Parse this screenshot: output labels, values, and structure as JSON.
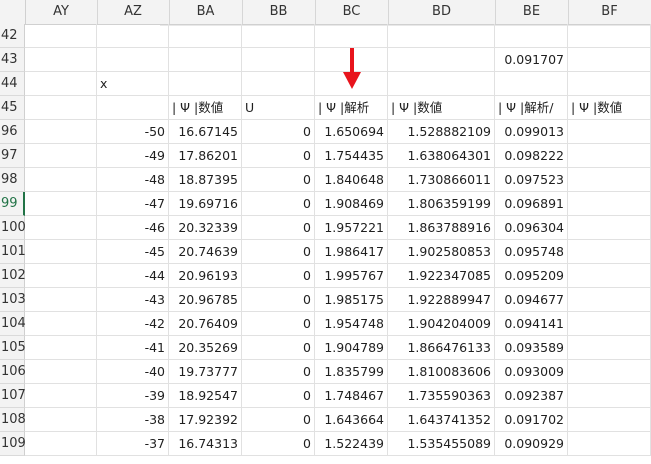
{
  "columns": [
    "AY",
    "AZ",
    "BA",
    "BB",
    "BC",
    "BD",
    "BE",
    "BF"
  ],
  "rows": [
    {
      "num": "42",
      "cells": [
        "",
        "",
        "",
        "",
        "",
        "",
        "",
        ""
      ]
    },
    {
      "num": "43",
      "cells": [
        "",
        "",
        "",
        "",
        "",
        "",
        "0.091707",
        ""
      ]
    },
    {
      "num": "44",
      "cells": [
        "",
        "x",
        "",
        "",
        "",
        "",
        "",
        ""
      ]
    },
    {
      "num": "45",
      "cells": [
        "",
        "",
        "| Ψ |数値",
        "U",
        "| Ψ |解析",
        "| Ψ |数値",
        "| Ψ |解析/",
        "| Ψ |数値"
      ]
    },
    {
      "num": "96",
      "cells": [
        "",
        "-50",
        "16.67145",
        "0",
        "1.650694",
        "1.528882109",
        "0.099013",
        ""
      ]
    },
    {
      "num": "97",
      "cells": [
        "",
        "-49",
        "17.86201",
        "0",
        "1.754435",
        "1.638064301",
        "0.098222",
        ""
      ]
    },
    {
      "num": "98",
      "cells": [
        "",
        "-48",
        "18.87395",
        "0",
        "1.840648",
        "1.730866011",
        "0.097523",
        ""
      ]
    },
    {
      "num": "99",
      "cells": [
        "",
        "-47",
        "19.69716",
        "0",
        "1.908469",
        "1.806359199",
        "0.096891",
        ""
      ]
    },
    {
      "num": "100",
      "cells": [
        "",
        "-46",
        "20.32339",
        "0",
        "1.957221",
        "1.863788916",
        "0.096304",
        ""
      ]
    },
    {
      "num": "101",
      "cells": [
        "",
        "-45",
        "20.74639",
        "0",
        "1.986417",
        "1.902580853",
        "0.095748",
        ""
      ]
    },
    {
      "num": "102",
      "cells": [
        "",
        "-44",
        "20.96193",
        "0",
        "1.995767",
        "1.922347085",
        "0.095209",
        ""
      ]
    },
    {
      "num": "103",
      "cells": [
        "",
        "-43",
        "20.96785",
        "0",
        "1.985175",
        "1.922889947",
        "0.094677",
        ""
      ]
    },
    {
      "num": "104",
      "cells": [
        "",
        "-42",
        "20.76409",
        "0",
        "1.954748",
        "1.904204009",
        "0.094141",
        ""
      ]
    },
    {
      "num": "105",
      "cells": [
        "",
        "-41",
        "20.35269",
        "0",
        "1.904789",
        "1.866476133",
        "0.093589",
        ""
      ]
    },
    {
      "num": "106",
      "cells": [
        "",
        "-40",
        "19.73777",
        "0",
        "1.835799",
        "1.810083606",
        "0.093009",
        ""
      ]
    },
    {
      "num": "107",
      "cells": [
        "",
        "-39",
        "18.92547",
        "0",
        "1.748467",
        "1.735590363",
        "0.092387",
        ""
      ]
    },
    {
      "num": "108",
      "cells": [
        "",
        "-38",
        "17.92392",
        "0",
        "1.643664",
        "1.643741352",
        "0.091702",
        ""
      ]
    },
    {
      "num": "109",
      "cells": [
        "",
        "-37",
        "16.74313",
        "0",
        "1.522439",
        "1.535455089",
        "0.090929",
        ""
      ]
    }
  ],
  "active_row": "99",
  "annotation": {
    "icon": "red-down-arrow-icon",
    "color": "#e8141c"
  }
}
